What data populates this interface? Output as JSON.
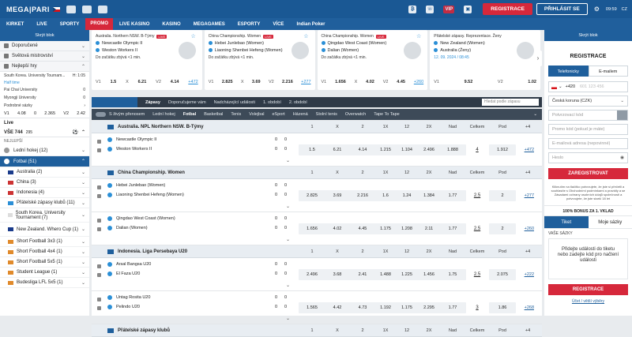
{
  "header": {
    "brand": "MEGA|PARI",
    "vip": "VIP",
    "register": "REGISTRACE",
    "login": "PŘIHLÁSIT SE",
    "time": "09:59",
    "lang": "CZ"
  },
  "nav": [
    "KIRKET",
    "LIVE",
    "SPORTY"
  ],
  "nav_promo": "PROMO",
  "nav_rest": [
    "LIVE KASINO",
    "KASINO",
    "MEGAGAMES",
    "ESPORTY",
    "VÍCE"
  ],
  "nav_indian": "Indian Poker",
  "left": {
    "hide": "Skrýt blok",
    "menu": [
      "Doporučené",
      "Světová mistrovství",
      "Nejlepší hry"
    ],
    "mini_match": {
      "league": "South Korea. University Tournam...",
      "time": "H: 1:05",
      "half": "Half time",
      "team1": "Pai Chai University",
      "team2": "Myongji University",
      "s1": "0",
      "s2": "0",
      "more": "Podrobné sázky"
    },
    "mini_odds": [
      "V1",
      "4.08",
      "0",
      "2.365",
      "V2",
      "2.42"
    ],
    "live": "Live",
    "all": "VŠE 744",
    "count": "295",
    "nejlepsi": "NEJLEPŠÍ",
    "sports": [
      {
        "label": "Lední hokej (12)"
      },
      {
        "label": "Fotbal (51)"
      }
    ],
    "subs": [
      "Australia (2)",
      "China (3)",
      "Indonesia (4)",
      "Přátelské zápasy klubů (11)",
      "South Korea. University Tournament (7)",
      "New Zealand. Whero Cup (1)",
      "Short Football 3x3 (1)",
      "Short Football 4x4 (1)",
      "Short Football 5x5 (1)",
      "Student League (1)",
      "Budesliga LFL 5x5 (1)"
    ]
  },
  "cards": [
    {
      "league": "Australia. Northern NSW. B-Týmy",
      "live": "LIVE",
      "t1": "Newcastle Olympic II",
      "t2": "Weston Workers II",
      "note": "Do začátku zbývá <1 min.",
      "v1": "1.5",
      "x": "6.21",
      "v2": "4.14",
      "plus": "+472",
      "l1": "V1",
      "lx": "X",
      "l2": "V2"
    },
    {
      "league": "China Championship. Women",
      "live": "LIVE",
      "t1": "Hebei Junlebao (Women)",
      "t2": "Liaoning Shenbei Hefeng (Women)",
      "note": "Do začátku zbývá <1 min.",
      "v1": "2.825",
      "x": "3.69",
      "v2": "2.216",
      "plus": "+277",
      "l1": "V1",
      "lx": "X",
      "l2": "V2"
    },
    {
      "league": "China Championship. Women",
      "live": "LIVE",
      "t1": "Qingdao West Coast (Women)",
      "t2": "Dalian (Women)",
      "note": "Do začátku zbývá <1 min.",
      "v1": "1.656",
      "x": "4.02",
      "v2": "4.45",
      "plus": "+260",
      "l1": "V1",
      "lx": "X",
      "l2": "V2"
    },
    {
      "league": "Přátelské zápasy. Reprezentace. Ženy",
      "live": "",
      "t1": "New Zealand (Women)",
      "t2": "Australia (Ženy)",
      "note": "12. 09. 2024 / 08:45",
      "v1": "9.52",
      "x": "",
      "v2": "1.02",
      "plus": "",
      "l1": "V1",
      "lx": "",
      "l2": "V2"
    }
  ],
  "filter1": [
    "Zápasy",
    "Doporučujeme vám",
    "Nadcházející události",
    "1. období",
    "2. období"
  ],
  "search": "Hledat podle zápasu",
  "filter2": [
    "S živým přenosem",
    "Lední hokej",
    "Fotbal",
    "Basketbal",
    "Tenis",
    "Volejbal",
    "eSport",
    "Házená",
    "Stolní tenis",
    "Overwatch",
    "Tape To Tape"
  ],
  "cols": [
    "1",
    "X",
    "2",
    "1X",
    "12",
    "2X",
    "Nad",
    "Celkem",
    "Pod"
  ],
  "leagues": [
    {
      "name": "Australia. NPL Northern NSW. B-Týmy",
      "more": "+4",
      "matches": [
        {
          "t1": "Newcastle Olympic II",
          "t2": "Weston Workers II",
          "s1": "0",
          "s2": "0",
          "s3": "0",
          "s4": "0",
          "odds": [
            "1.5",
            "6.21",
            "4.14",
            "1.215",
            "1.104",
            "2.496",
            "1.888",
            "4",
            "1.912"
          ],
          "plus": "+472"
        }
      ]
    },
    {
      "name": "China Championship. Women",
      "more": "+4",
      "matches": [
        {
          "t1": "Hebei Junlebao (Women)",
          "t2": "Liaoning Shenbei Hefeng (Women)",
          "s1": "0",
          "s2": "0",
          "s3": "0",
          "s4": "0",
          "odds": [
            "2.825",
            "3.69",
            "2.216",
            "1.6",
            "1.24",
            "1.384",
            "1.77",
            "2.5",
            "2"
          ],
          "plus": "+277"
        },
        {
          "t1": "Qingdao West Coast (Women)",
          "t2": "Dalian (Women)",
          "s1": "0",
          "s2": "0",
          "s3": "0",
          "s4": "0",
          "odds": [
            "1.656",
            "4.02",
            "4.45",
            "1.175",
            "1.208",
            "2.11",
            "1.77",
            "2.5",
            "2"
          ],
          "plus": "+260"
        }
      ]
    },
    {
      "name": "Indonesia. Liga Persebaya U20",
      "more": "+4",
      "matches": [
        {
          "t1": "Arsal Bangsa U20",
          "t2": "El Faza U20",
          "s1": "0",
          "s2": "0",
          "s3": "0",
          "s4": "0",
          "odds": [
            "2.496",
            "3.68",
            "2.41",
            "1.488",
            "1.225",
            "1.456",
            "1.75",
            "2.5",
            "2.075"
          ],
          "plus": "+222"
        },
        {
          "t1": "Untag Rosita U20",
          "t2": "Pelindo U20",
          "s1": "0",
          "s2": "0",
          "s3": "0",
          "s4": "0",
          "odds": [
            "1.565",
            "4.42",
            "4.73",
            "1.192",
            "1.175",
            "2.295",
            "1.77",
            "3",
            "1.86"
          ],
          "plus": "+268"
        }
      ]
    },
    {
      "name": "Přátelské zápasy klubů",
      "more": "+4",
      "matches": []
    }
  ],
  "right": {
    "hide": "Skrýt blok",
    "title": "REGISTRACE",
    "tab1": "Telefonicky",
    "tab2": "E-mailem",
    "prefix": "+420",
    "phone_ph": "601 123 456",
    "country": "Česká koruna (CZK)",
    "code_ph": "Potvrzovací kód",
    "promo_ph": "Promo kód (pokud je máte)",
    "email_ph": "E-mailová adresa (nepovinné)",
    "pass_ph": "Heslo",
    "register": "ZAREGISTROVAT",
    "legal": "Kliknutím na tlačítko potvrzujete, že jste si přečetli a souhlasíte s Obchodními podmínkami a pravidly a se Zásadami ochrany osobních údajů společnosti a potvrzujete, že jste starší 18 let",
    "bonus": "100% BONUS ZA 1. VKLAD",
    "ticket": "Tiket",
    "bets": "Moje sázky",
    "vase": "VAŠE SÁZKY",
    "msg": "Přidejte události do tiketu nebo zadejte kód pro načtení události",
    "register2": "REGISTRACE",
    "ucet": "Účet / větší výběry"
  }
}
